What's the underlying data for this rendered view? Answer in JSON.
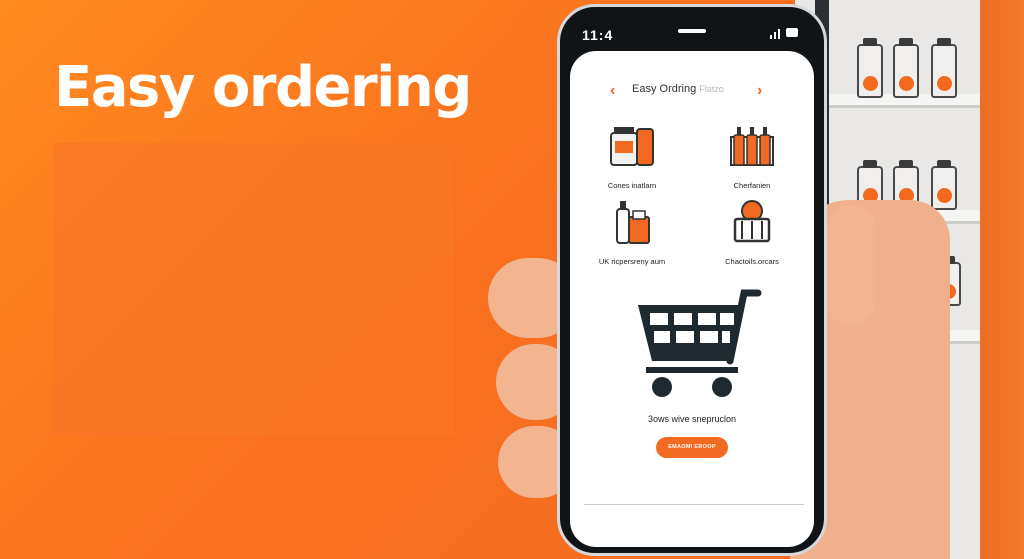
{
  "headline": "Easy ordering",
  "phone": {
    "status_time": "11:4",
    "nav": {
      "prev_icon": "chevron-left-icon",
      "next_icon": "chevron-right-icon",
      "title": "Easy Ordring",
      "title_suffix": "Flatzo"
    },
    "categories": [
      {
        "label": "Cones inatlarn",
        "icon": "jar-products-icon"
      },
      {
        "label": "Cherfanien",
        "icon": "bottles-icon"
      },
      {
        "label": "UK ricpersreny aum",
        "icon": "bottle-bag-icon"
      },
      {
        "label": "Chactoils.orcars",
        "icon": "basket-icon"
      }
    ],
    "cart_icon": "shopping-cart-icon",
    "caption": "3ows wive snepruclon",
    "cta_label": "EMAOMI EROOP"
  },
  "colors": {
    "accent": "#f26a22",
    "background": "#fa7a21",
    "panel": "#f97725"
  }
}
